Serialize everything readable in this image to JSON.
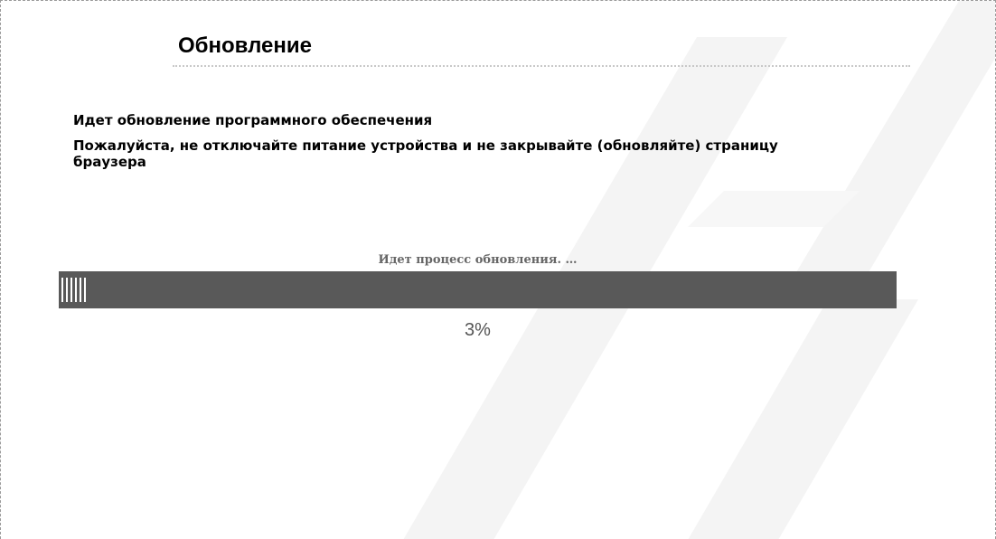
{
  "page": {
    "title": "Обновление",
    "message_line1": "Идет обновление программного обеспечения",
    "message_line2": "Пожалуйста, не отключайте питание устройства и не закрывайте (обновляйте) страницу браузера"
  },
  "progress": {
    "status_text": "Идет процесс обновления. …",
    "percent_label": "3%",
    "fraction": 0.03,
    "track_color": "#595959",
    "fill_color": "#ffffff"
  },
  "watermark": {
    "icon": "brand-logo-watermark-icon"
  }
}
